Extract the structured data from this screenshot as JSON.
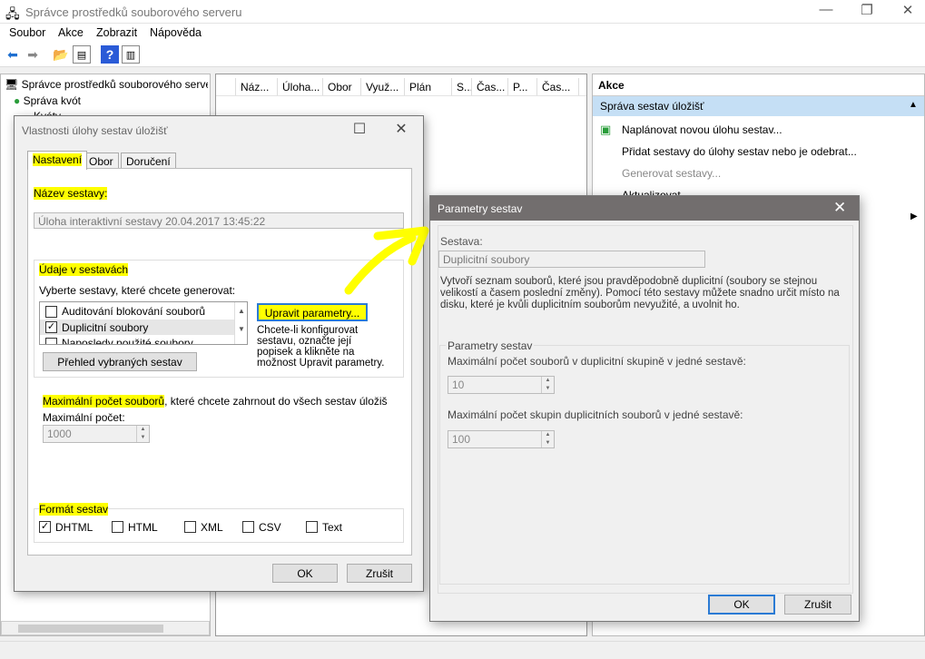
{
  "window": {
    "title": "Správce prostředků souborového serveru",
    "minimize": "—",
    "maximize": "❐",
    "close": "✕"
  },
  "menu": [
    "Soubor",
    "Akce",
    "Zobrazit",
    "Nápověda"
  ],
  "tree": {
    "root": "Správce prostředků souborového serveru",
    "child1": "Správa kvót",
    "child2": "Kvóty"
  },
  "list": {
    "columns": [
      "Náz...",
      "Úloha...",
      "Obor",
      "Využ...",
      "Plán",
      "S...",
      "Čas...",
      "P...",
      "Čas..."
    ]
  },
  "actions": {
    "header": "Akce",
    "section": "Správa sestav úložišť",
    "items": [
      "Naplánovat novou úlohu sestav...",
      "Přidat sestavy do úlohy sestav nebo je odebrat...",
      "Generovat sestavy...",
      "Aktualizovat"
    ]
  },
  "dialog1": {
    "title": "Vlastnosti úlohy sestav úložišť",
    "tabs": [
      "Nastavení",
      "Obor",
      "Doručení"
    ],
    "name_label": "Název sestavy:",
    "name_value": "Úloha interaktivní sestavy 20.04.2017 13:45:22",
    "data_group": "Údaje v sestavách",
    "select_label": "Vyberte sestavy, které chcete generovat:",
    "reports": [
      {
        "label": "Auditování blokování souborů",
        "checked": false
      },
      {
        "label": "Duplicitní soubory",
        "checked": true
      },
      {
        "label": "Naposledy použité soubory",
        "checked": false
      }
    ],
    "edit_params_button": "Upravit parametry...",
    "edit_params_hint": [
      "Chcete-li konfigurovat",
      "sestavu, označte její",
      "popisek a klikněte na",
      "možnost Upravit parametry."
    ],
    "review_button": "Přehled vybraných sestav",
    "max_label_hl": "Maximální počet souborů",
    "max_label_rest": ", které chcete zahrnout do všech sestav úložiš",
    "max_field_label": "Maximální počet:",
    "max_value": "1000",
    "format_group": "Formát sestav",
    "formats": [
      {
        "label": "DHTML",
        "checked": true
      },
      {
        "label": "HTML",
        "checked": false
      },
      {
        "label": "XML",
        "checked": false
      },
      {
        "label": "CSV",
        "checked": false
      },
      {
        "label": "Text",
        "checked": false
      }
    ],
    "ok": "OK",
    "cancel": "Zrušit"
  },
  "dialog2": {
    "title": "Parametry sestav",
    "report_label": "Sestava:",
    "report_value": "Duplicitní soubory",
    "description": "Vytvoří seznam souborů, které jsou pravděpodobně duplicitní (soubory se stejnou velikostí a časem poslední změny). Pomocí této sestavy můžete snadno určit místo na disku, které je kvůli duplicitním souborům nevyužité, a uvolnit ho.",
    "params_group": "Parametry sestav",
    "param1_label": "Maximální počet souborů v duplicitní skupině v jedné sestavě:",
    "param1_value": "10",
    "param2_label": "Maximální počet skupin duplicitních souborů v jedné sestavě:",
    "param2_value": "100",
    "ok": "OK",
    "cancel": "Zrušit"
  },
  "colors": {
    "highlight": "#ffff00",
    "selection": "#c5dff5",
    "dialog_title": "#726e6e"
  }
}
